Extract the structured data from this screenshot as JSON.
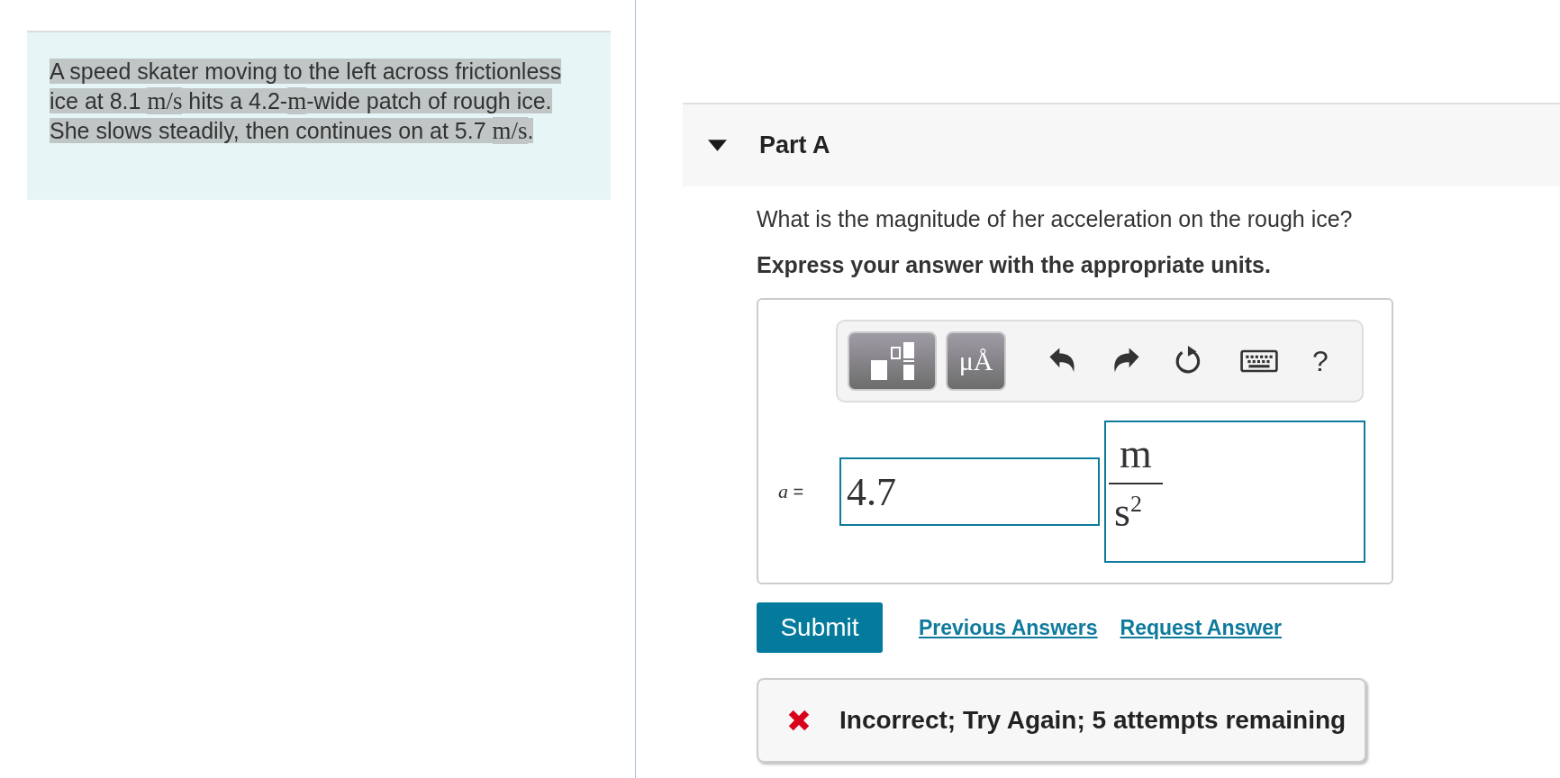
{
  "problem": {
    "segments": [
      {
        "kind": "text",
        "text": "A speed skater moving to the left across frictionless ice at 8.1 "
      },
      {
        "kind": "math",
        "text": "m/s"
      },
      {
        "kind": "text",
        "text": " hits a 4.2-"
      },
      {
        "kind": "math",
        "text": "m"
      },
      {
        "kind": "text",
        "text": "-wide patch of rough ice. She slows steadily, then continues on at 5.7 "
      },
      {
        "kind": "math",
        "text": "m/s"
      },
      {
        "kind": "text",
        "text": "."
      }
    ]
  },
  "part": {
    "title": "Part A",
    "expanded": true,
    "question": "What is the magnitude of her acceleration on the rough ice?",
    "instruction": "Express your answer with the appropriate units.",
    "toolbar": [
      {
        "kind": "templates"
      },
      {
        "kind": "units",
        "label": "μÅ"
      },
      {
        "kind": "undo"
      },
      {
        "kind": "redo"
      },
      {
        "kind": "reset"
      },
      {
        "kind": "keyboard"
      },
      {
        "kind": "help",
        "label": "?"
      }
    ],
    "variable": "a",
    "equals": "=",
    "value": "4.7",
    "unit": {
      "numerator": "m",
      "denominator": "s$^{2}$"
    },
    "submit": "Submit",
    "links": [
      "Previous Answers",
      "Request Answer"
    ],
    "feedback": {
      "correct": false,
      "text": "Incorrect; Try Again; 5 attempts remaining"
    }
  }
}
